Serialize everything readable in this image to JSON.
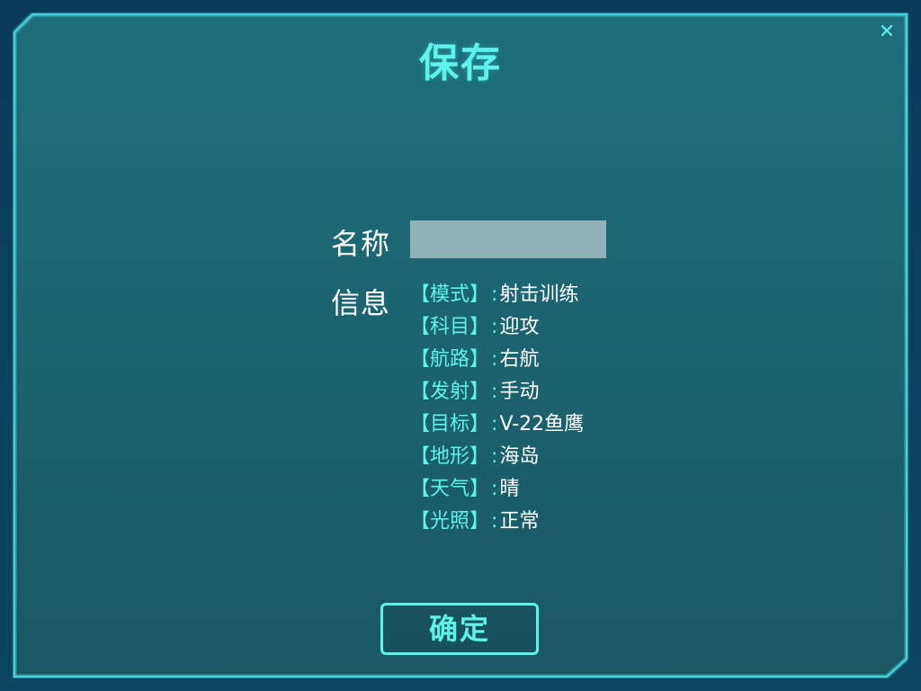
{
  "dialog": {
    "title": "保存",
    "close_glyph": "✕"
  },
  "form": {
    "name_label": "名称",
    "name_value": "",
    "info_label": "信息",
    "separator": ":",
    "info_items": [
      {
        "key": "【模式】",
        "value": "射击训练"
      },
      {
        "key": "【科目】",
        "value": "迎攻"
      },
      {
        "key": "【航路】",
        "value": "右航"
      },
      {
        "key": "【发射】",
        "value": "手动"
      },
      {
        "key": "【目标】",
        "value": "V-22鱼鹰"
      },
      {
        "key": "【地形】",
        "value": "海岛"
      },
      {
        "key": "【天气】",
        "value": "晴"
      },
      {
        "key": "【光照】",
        "value": "正常"
      }
    ]
  },
  "actions": {
    "confirm_label": "确定"
  },
  "icons": {
    "close": "close-icon"
  },
  "colors": {
    "accent": "#5ff2ea",
    "panel_bg": "#1f6d7b",
    "input_bg": "#8fb2b7",
    "text": "#ffffff"
  }
}
